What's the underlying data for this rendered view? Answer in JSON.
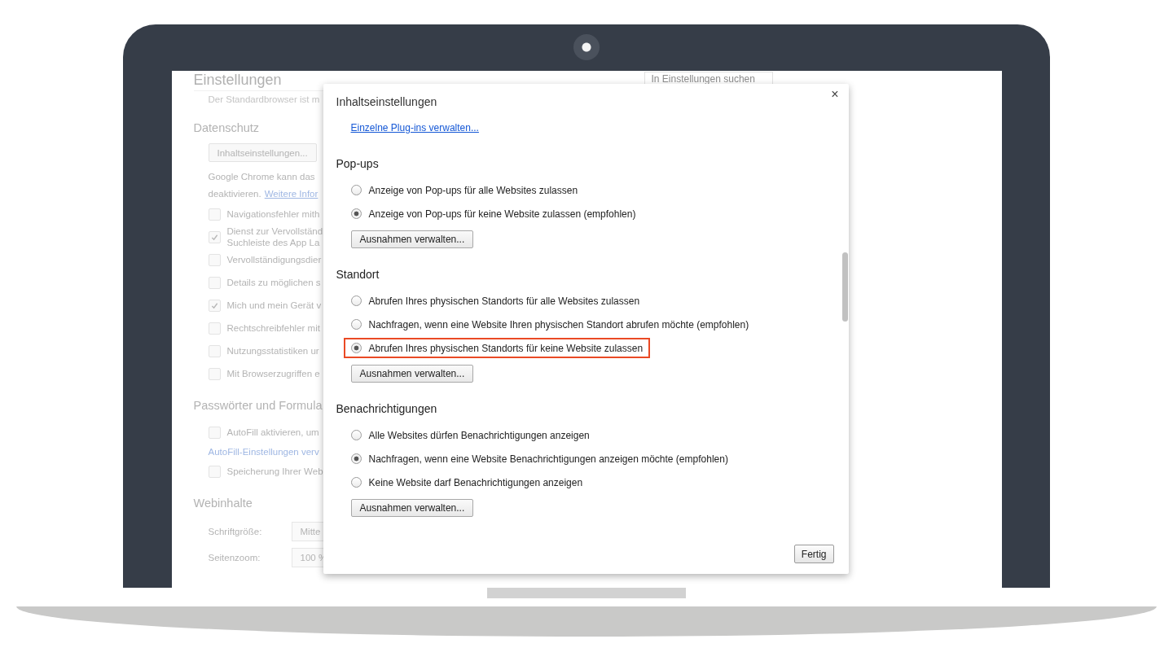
{
  "background_page": {
    "title": "Einstellungen",
    "search": {
      "placeholder": "In Einstellungen suchen"
    },
    "intro_text": "Der Standardbrowser ist m",
    "sections": [
      {
        "heading": "Datenschutz",
        "items": [
          {
            "kind": "button",
            "label": "Inhaltseinstellungen..."
          },
          {
            "kind": "text",
            "text": "Google Chrome kann das"
          },
          {
            "kind": "text_link",
            "text": "deaktivieren.",
            "link": "Weitere Infor"
          },
          {
            "kind": "checkbox",
            "label": "Navigationsfehler mith",
            "checked": false
          },
          {
            "kind": "checkbox",
            "label": "Dienst zur Vervollständ\nSuchleiste des App La",
            "checked": true
          },
          {
            "kind": "checkbox",
            "label": "Vervollständigungsdier",
            "checked": false
          },
          {
            "kind": "checkbox",
            "label": "Details zu möglichen s",
            "checked": false
          },
          {
            "kind": "checkbox",
            "label": "Mich und mein Gerät v",
            "checked": true
          },
          {
            "kind": "checkbox",
            "label": "Rechtschreibfehler mit",
            "checked": false
          },
          {
            "kind": "checkbox",
            "label": "Nutzungsstatistiken ur",
            "checked": false
          },
          {
            "kind": "checkbox",
            "label": "Mit Browserzugriffen e",
            "checked": false
          }
        ]
      },
      {
        "heading": "Passwörter und Formula",
        "items": [
          {
            "kind": "checkbox",
            "label": "AutoFill aktivieren, um",
            "checked": false
          },
          {
            "kind": "link",
            "link": "AutoFill-Einstellungen verv"
          },
          {
            "kind": "checkbox",
            "label": "Speicherung Ihrer Web",
            "checked": false
          }
        ]
      },
      {
        "heading": "Webinhalte",
        "items": [
          {
            "kind": "select",
            "label": "Schriftgröße:",
            "value": "Mitte"
          },
          {
            "kind": "select",
            "label": "Seitenzoom:",
            "value": "100 %"
          }
        ]
      }
    ]
  },
  "dialog": {
    "title": "Inhaltseinstellungen",
    "close": "×",
    "link": "Einzelne Plug-ins verwalten...",
    "sections": [
      {
        "heading": "Pop-ups",
        "options": [
          {
            "label": "Anzeige von Pop-ups für alle Websites zulassen",
            "selected": false,
            "highlighted": false
          },
          {
            "label": "Anzeige von Pop-ups für keine Website zulassen (empfohlen)",
            "selected": true,
            "highlighted": false
          }
        ],
        "button": "Ausnahmen verwalten..."
      },
      {
        "heading": "Standort",
        "options": [
          {
            "label": "Abrufen Ihres physischen Standorts für alle Websites zulassen",
            "selected": false,
            "highlighted": false
          },
          {
            "label": "Nachfragen, wenn eine Website Ihren physischen Standort abrufen möchte (empfohlen)",
            "selected": false,
            "highlighted": false
          },
          {
            "label": "Abrufen Ihres physischen Standorts für keine Website zulassen",
            "selected": true,
            "highlighted": true
          }
        ],
        "button": "Ausnahmen verwalten..."
      },
      {
        "heading": "Benachrichtigungen",
        "options": [
          {
            "label": "Alle Websites dürfen Benachrichtigungen anzeigen",
            "selected": false,
            "highlighted": false
          },
          {
            "label": "Nachfragen, wenn eine Website Benachrichtigungen anzeigen möchte (empfohlen)",
            "selected": true,
            "highlighted": false
          },
          {
            "label": "Keine Website darf Benachrichtigungen anzeigen",
            "selected": false,
            "highlighted": false
          }
        ],
        "button": "Ausnahmen verwalten..."
      }
    ],
    "done_button": "Fertig"
  }
}
